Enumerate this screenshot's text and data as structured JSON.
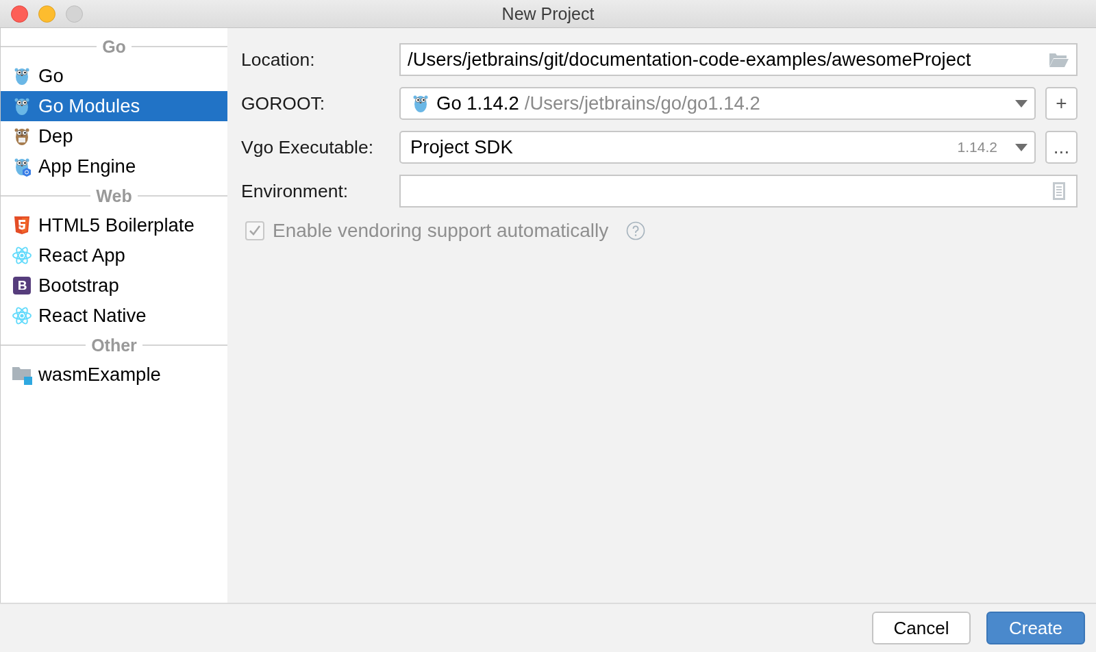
{
  "window": {
    "title": "New Project"
  },
  "sidebar": {
    "groups": [
      {
        "header": "Go",
        "items": [
          {
            "label": "Go",
            "kind": "gopher",
            "selected": false
          },
          {
            "label": "Go Modules",
            "kind": "gopher",
            "selected": true
          },
          {
            "label": "Dep",
            "kind": "gopher-brown",
            "selected": false
          },
          {
            "label": "App Engine",
            "kind": "gopher-cloud",
            "selected": false
          }
        ]
      },
      {
        "header": "Web",
        "items": [
          {
            "label": "HTML5 Boilerplate",
            "kind": "html5",
            "selected": false
          },
          {
            "label": "React App",
            "kind": "react",
            "selected": false
          },
          {
            "label": "Bootstrap",
            "kind": "bootstrap",
            "selected": false
          },
          {
            "label": "React Native",
            "kind": "react",
            "selected": false
          }
        ]
      },
      {
        "header": "Other",
        "items": [
          {
            "label": "wasmExample",
            "kind": "folder",
            "selected": false
          }
        ]
      }
    ]
  },
  "form": {
    "rows": [
      {
        "label": "Location:",
        "kind": "path",
        "value": "/Users/jetbrains/git/documentation-code-examples/awesomeProject"
      },
      {
        "label": "GOROOT:",
        "kind": "sdk",
        "value": "Go 1.14.2",
        "detail": "/Users/jetbrains/go/go1.14.2",
        "button": "+"
      },
      {
        "label": "Vgo Executable:",
        "kind": "combo",
        "value": "Project SDK",
        "detail": "1.14.2",
        "button": "..."
      },
      {
        "label": "Environment:",
        "kind": "env"
      }
    ],
    "checkbox": {
      "label": "Enable vendoring support automatically",
      "checked": true,
      "disabled": true
    }
  },
  "buttons": [
    {
      "label": "Cancel",
      "kind": "secondary"
    },
    {
      "label": "Create",
      "kind": "primary"
    }
  ]
}
